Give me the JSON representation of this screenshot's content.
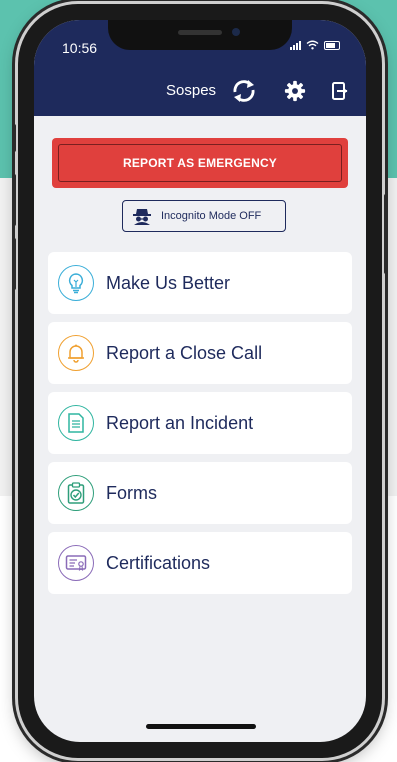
{
  "status": {
    "time": "10:56"
  },
  "header": {
    "title": "Sospes"
  },
  "emergency": {
    "label": "REPORT AS EMERGENCY"
  },
  "incognito": {
    "label": "Incognito Mode OFF"
  },
  "menu": [
    {
      "label": "Make Us Better",
      "icon": "lightbulb-icon",
      "color": "#3aaed8"
    },
    {
      "label": "Report a Close Call",
      "icon": "bell-icon",
      "color": "#f0a030"
    },
    {
      "label": "Report an Incident",
      "icon": "document-icon",
      "color": "#2fb5a0"
    },
    {
      "label": "Forms",
      "icon": "clipboard-check-icon",
      "color": "#2e9e7a"
    },
    {
      "label": "Certifications",
      "icon": "certificate-icon",
      "color": "#8a6bb8"
    }
  ],
  "colors": {
    "navy": "#1e2a5c",
    "teal": "#5cc2ae",
    "emergency_red": "#e0403d"
  }
}
